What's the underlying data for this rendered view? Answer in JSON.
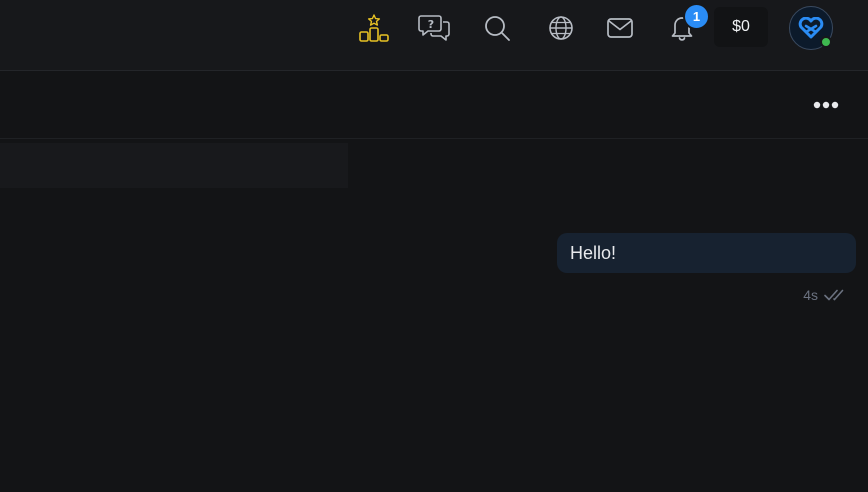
{
  "header": {
    "notifications_count": "1",
    "balance": "$0",
    "icons": {
      "leaderboard": "leaderboard-icon",
      "help_chat": "help-chat-icon",
      "search": "search-icon",
      "language": "globe-icon",
      "messages": "mail-icon",
      "notifications": "bell-icon"
    },
    "colors": {
      "accent_gold": "#e8c224",
      "badge_blue": "#2a8cf5",
      "online_green": "#3fb950"
    }
  },
  "chat": {
    "messages": [
      {
        "text": "Hello!",
        "time": "4s",
        "status": "read"
      }
    ]
  }
}
